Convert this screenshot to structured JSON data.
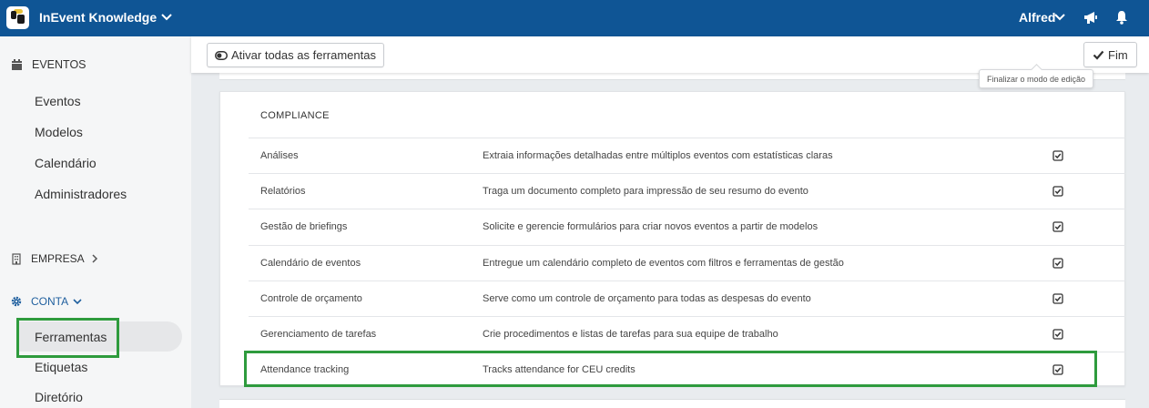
{
  "header": {
    "brand_name": "InEvent Knowledge",
    "user_name": "Alfred"
  },
  "sidebar": {
    "eventos_section": "EVENTOS",
    "eventos_items": [
      "Eventos",
      "Modelos",
      "Calendário",
      "Administradores"
    ],
    "empresa_section": "EMPRESA",
    "conta_section": "CONTA",
    "conta_items": [
      "Ferramentas",
      "Etiquetas",
      "Diretório"
    ],
    "active_item": "Ferramentas"
  },
  "toolbar": {
    "activate_all_label": "Ativar todas as ferramentas",
    "finish_label": "Fim",
    "finish_tooltip": "Finalizar o modo de edição"
  },
  "compliance": {
    "title": "COMPLIANCE",
    "rows": [
      {
        "name": "Análises",
        "description": "Extraia informações detalhadas entre múltiplos eventos com estatísticas claras",
        "checked": true
      },
      {
        "name": "Relatórios",
        "description": "Traga um documento completo para impressão de seu resumo do evento",
        "checked": true
      },
      {
        "name": "Gestão de briefings",
        "description": "Solicite e gerencie formulários para criar novos eventos a partir de modelos",
        "checked": true
      },
      {
        "name": "Calendário de eventos",
        "description": "Entregue um calendário completo de eventos com filtros e ferramentas de gestão",
        "checked": true
      },
      {
        "name": "Controle de orçamento",
        "description": "Serve como um controle de orçamento para todas as despesas do evento",
        "checked": true
      },
      {
        "name": "Gerenciamento de tarefas",
        "description": "Crie procedimentos e listas de tarefas para sua equipe de trabalho",
        "checked": true
      },
      {
        "name": "Attendance tracking",
        "description": "Tracks attendance for CEU credits",
        "checked": true
      }
    ]
  },
  "colors": {
    "topbar": "#0f5595",
    "highlight": "#2e9b3d",
    "sidebar_bg": "#f5f6f7"
  },
  "icons": {
    "brand": "inevent-logo-icon",
    "megaphone": "megaphone-icon",
    "bell": "bell-icon",
    "calendar": "calendar-icon",
    "building": "building-icon",
    "gear": "gear-icon",
    "toggle": "toggle-icon",
    "check": "check-icon",
    "checkbox": "checkbox-checked-icon"
  }
}
